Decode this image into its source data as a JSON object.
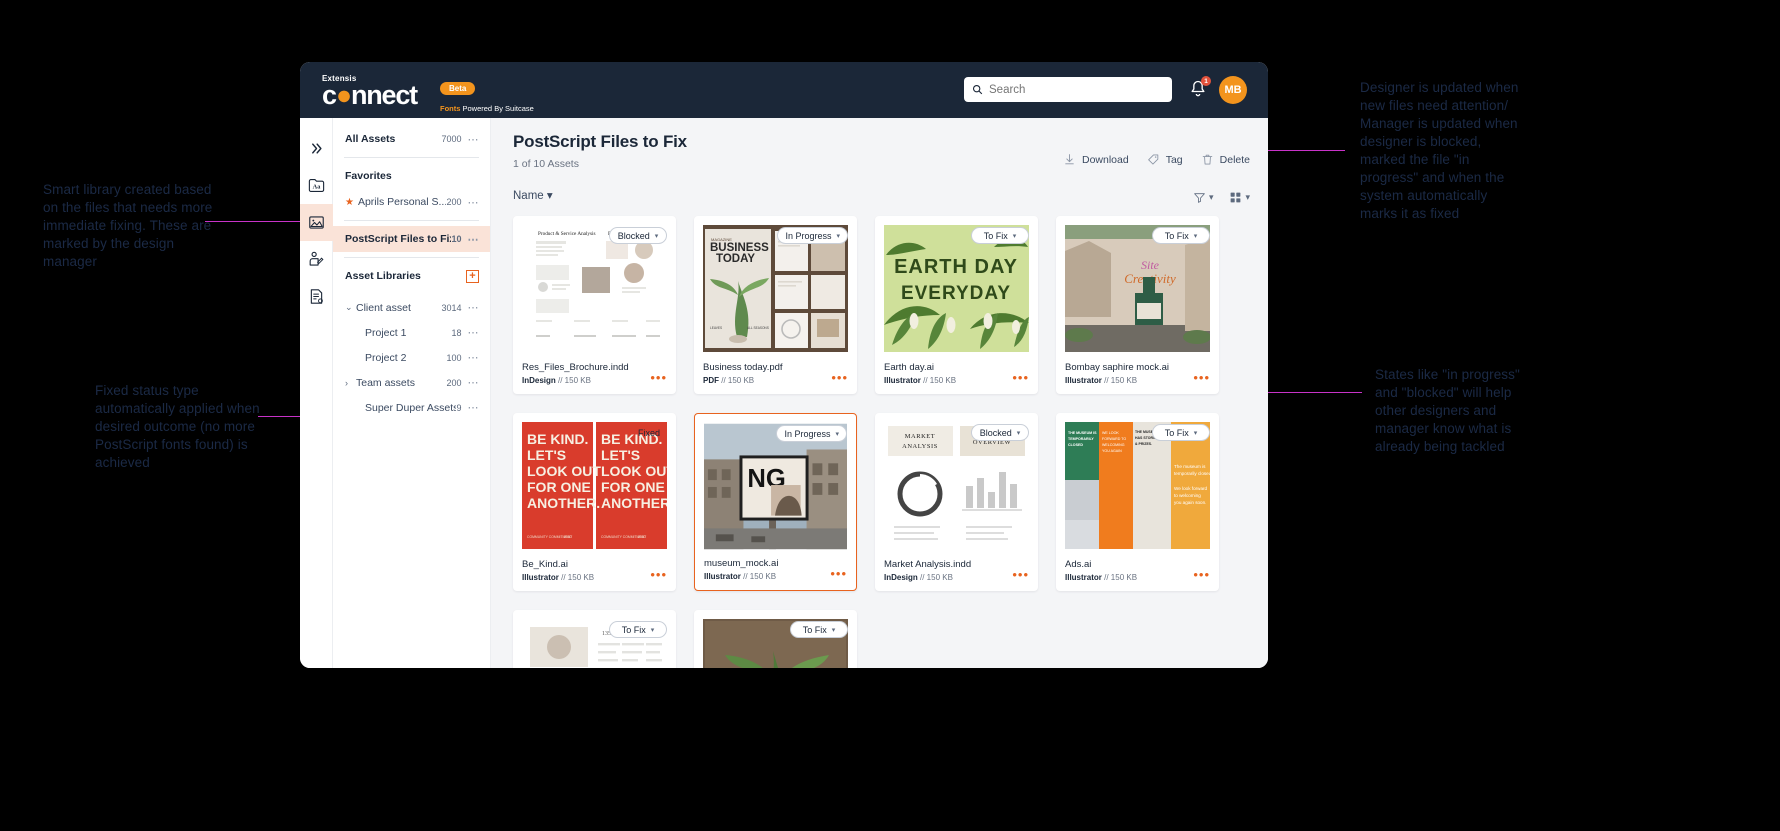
{
  "annotations": [
    {
      "id": "left-smart-library",
      "text": "Smart library created based on the files that needs more immediate fixing. These are marked by the design manager"
    },
    {
      "id": "left-fixed-status",
      "text": "Fixed status type automatically applied when desired outcome (no more PostScript fonts found) is achieved"
    },
    {
      "id": "right-designer-updated",
      "text": "Designer is updated when new files need attention/ Manager is updated when designer is blocked, marked the file \"in progress\" and when the system automatically marks it as fixed"
    },
    {
      "id": "right-states",
      "text": "States like \"in progress\" and \"blocked\" will help other designers and manager know what is already being tackled"
    }
  ],
  "header": {
    "brand_small": "Extensis",
    "brand_main": "connect",
    "beta_label": "Beta",
    "brand_tagline_bold": "Fonts",
    "brand_tagline_rest": " Powered By Suitcase",
    "search_placeholder": "Search",
    "search_value": "",
    "notification_count": "1",
    "avatar_initials": "MB"
  },
  "rail": [
    {
      "name": "collapse",
      "icon": "chevrons-right-icon",
      "active": false
    },
    {
      "name": "fonts",
      "icon": "typeface-icon",
      "active": false
    },
    {
      "name": "assets",
      "icon": "image-icon",
      "active": true
    },
    {
      "name": "people",
      "icon": "person-edit-icon",
      "active": false
    },
    {
      "name": "reports",
      "icon": "document-icon",
      "active": false
    }
  ],
  "sidebar": {
    "all_assets": {
      "label": "All Assets",
      "count": "7000"
    },
    "favorites_header": "Favorites",
    "favorites": [
      {
        "label": "Aprils Personal S...",
        "count": "200"
      }
    ],
    "smart_library": {
      "label": "PostScript Files to Fix",
      "count": "10"
    },
    "asset_libraries_header": "Asset Libraries",
    "libraries": [
      {
        "label": "Client asset",
        "count": "3014",
        "caret": "⌄",
        "indent": 0
      },
      {
        "label": "Project 1",
        "count": "18",
        "caret": "",
        "indent": 1
      },
      {
        "label": "Project 2",
        "count": "100",
        "caret": "",
        "indent": 1
      },
      {
        "label": "Team assets",
        "count": "200",
        "caret": "›",
        "indent": 0
      },
      {
        "label": "Super Duper Assets",
        "count": "9",
        "caret": "",
        "indent": 1
      }
    ]
  },
  "main": {
    "title": "PostScript Files to Fix",
    "subtitle": "1 of  10 Assets",
    "toolbar": [
      {
        "label": "Download",
        "icon": "download-icon"
      },
      {
        "label": "Tag",
        "icon": "tag-icon"
      },
      {
        "label": "Delete",
        "icon": "trash-icon"
      }
    ],
    "sort_label": "Name",
    "view_controls": [
      {
        "name": "filter-icon"
      },
      {
        "name": "grid-view-icon"
      }
    ],
    "assets": [
      {
        "name": "Res_Files_Brochure.indd",
        "app": "InDesign",
        "size": "150 KB",
        "status": "Blocked",
        "badge_style": "dropdown",
        "selected": false,
        "art": "brochure"
      },
      {
        "name": "Business today.pdf",
        "app": "PDF",
        "size": "150 KB",
        "status": "In Progress",
        "badge_style": "dropdown",
        "selected": false,
        "art": "business"
      },
      {
        "name": "Earth day.ai",
        "app": "Illustrator",
        "size": "150 KB",
        "status": "To Fix",
        "badge_style": "dropdown",
        "selected": false,
        "art": "earthday"
      },
      {
        "name": "Bombay saphire mock.ai",
        "app": "Illustrator",
        "size": "150 KB",
        "status": "To Fix",
        "badge_style": "dropdown",
        "selected": false,
        "art": "mural"
      },
      {
        "name": "Be_Kind.ai",
        "app": "Illustrator",
        "size": "150 KB",
        "status": "Fixed",
        "badge_style": "plain",
        "selected": false,
        "art": "bekind"
      },
      {
        "name": "museum_mock.ai",
        "app": "Illustrator",
        "size": "150 KB",
        "status": "In Progress",
        "badge_style": "dropdown",
        "selected": true,
        "art": "billboard"
      },
      {
        "name": "Market Analysis.indd",
        "app": "InDesign",
        "size": "150 KB",
        "status": "Blocked",
        "badge_style": "dropdown",
        "selected": false,
        "art": "market"
      },
      {
        "name": "Ads.ai",
        "app": "Illustrator",
        "size": "150 KB",
        "status": "To Fix",
        "badge_style": "dropdown",
        "selected": false,
        "art": "ads"
      },
      {
        "name": "",
        "app": "",
        "size": "",
        "status": "To Fix",
        "badge_style": "dropdown",
        "selected": false,
        "art": "doc2"
      },
      {
        "name": "",
        "app": "",
        "size": "",
        "status": "To Fix",
        "badge_style": "dropdown",
        "selected": false,
        "art": "plant2"
      }
    ]
  },
  "colors": {
    "brand_orange": "#f3941d",
    "navy": "#1b2738",
    "accent_pink": "#c832c8",
    "selected_border": "#e8631f",
    "highlight_bg": "#fae3d8"
  }
}
